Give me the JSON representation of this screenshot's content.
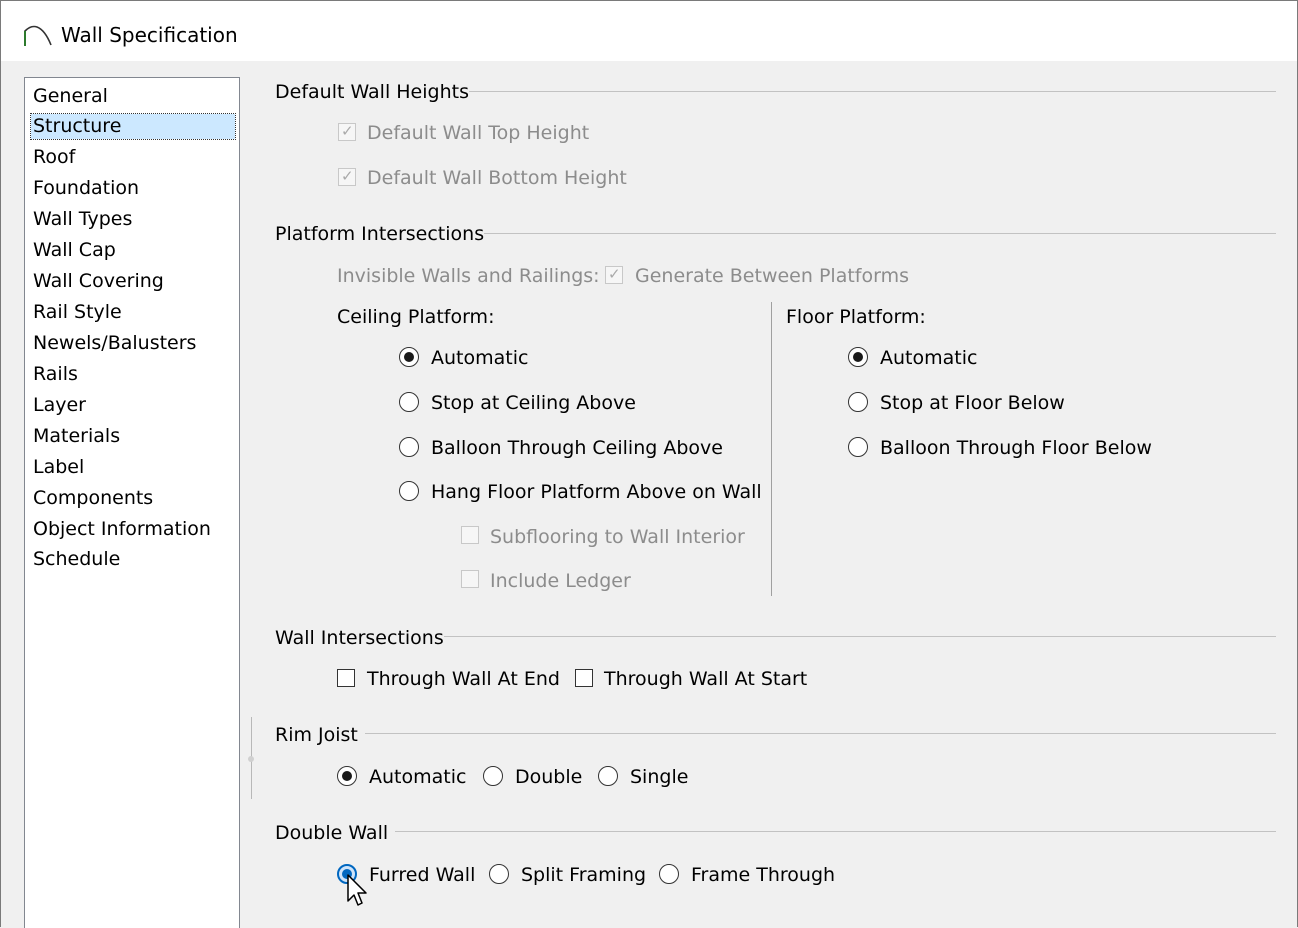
{
  "window": {
    "title": "Wall Specification"
  },
  "sidebar": {
    "items": [
      "General",
      "Structure",
      "Roof",
      "Foundation",
      "Wall Types",
      "Wall Cap",
      "Wall Covering",
      "Rail Style",
      "Newels/Balusters",
      "Rails",
      "Layer",
      "Materials",
      "Label",
      "Components",
      "Object Information",
      "Schedule"
    ],
    "selected": "Structure"
  },
  "default_wall_heights": {
    "heading": "Default Wall Heights",
    "top_height": {
      "label": "Default Wall Top Height",
      "checked": true,
      "enabled": false
    },
    "bottom_height": {
      "label": "Default Wall Bottom Height",
      "checked": true,
      "enabled": false
    }
  },
  "platform_intersections": {
    "heading": "Platform Intersections",
    "invisible_label": "Invisible Walls and Railings:",
    "generate_between": {
      "label": "Generate Between Platforms",
      "checked": true,
      "enabled": false
    },
    "ceiling": {
      "label": "Ceiling Platform:",
      "options": [
        "Automatic",
        "Stop at Ceiling Above",
        "Balloon Through Ceiling Above",
        "Hang Floor Platform Above on Wall"
      ],
      "selected": "Automatic",
      "subflooring": {
        "label": "Subflooring to Wall Interior",
        "checked": false,
        "enabled": false
      },
      "ledger": {
        "label": "Include Ledger",
        "checked": false,
        "enabled": false
      }
    },
    "floor": {
      "label": "Floor Platform:",
      "options": [
        "Automatic",
        "Stop at Floor Below",
        "Balloon Through Floor Below"
      ],
      "selected": "Automatic"
    }
  },
  "wall_intersections": {
    "heading": "Wall Intersections",
    "at_end": {
      "label": "Through Wall At End",
      "checked": false
    },
    "at_start": {
      "label": "Through Wall At Start",
      "checked": false
    }
  },
  "rim_joist": {
    "heading": "Rim Joist",
    "options": [
      "Automatic",
      "Double",
      "Single"
    ],
    "selected": "Automatic"
  },
  "double_wall": {
    "heading": "Double Wall",
    "options": [
      "Furred Wall",
      "Split Framing",
      "Frame Through"
    ],
    "selected": "Furred Wall"
  },
  "colors": {
    "selection": "#cce8ff",
    "focus": "#0067c0",
    "disabled_text": "#8c8c8c"
  }
}
